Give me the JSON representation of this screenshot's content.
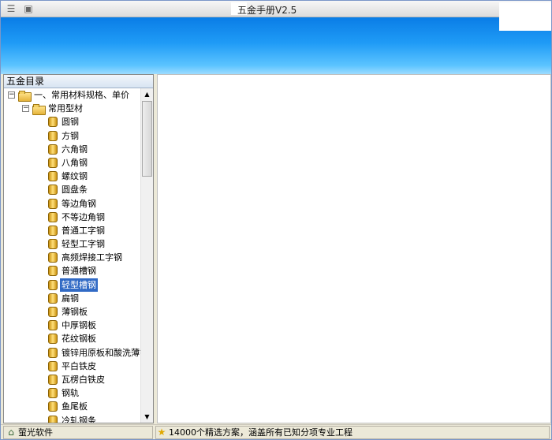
{
  "window": {
    "title": "五金手册V2.5"
  },
  "tree": {
    "header": "五金目录",
    "root": {
      "label": "一、常用材料规格、单价",
      "expander": "−"
    },
    "folder": {
      "label": "常用型材",
      "expander": "−"
    },
    "items": [
      {
        "label": "圆钢"
      },
      {
        "label": "方钢"
      },
      {
        "label": "六角钢"
      },
      {
        "label": "八角钢"
      },
      {
        "label": "螺纹钢"
      },
      {
        "label": "圆盘条"
      },
      {
        "label": "等边角钢"
      },
      {
        "label": "不等边角钢"
      },
      {
        "label": "普通工字钢"
      },
      {
        "label": "轻型工字钢"
      },
      {
        "label": "高频焊接工字钢"
      },
      {
        "label": "普通槽钢"
      },
      {
        "label": "轻型槽钢"
      },
      {
        "label": "扁钢"
      },
      {
        "label": "薄钢板"
      },
      {
        "label": "中厚钢板"
      },
      {
        "label": "花纹钢板"
      },
      {
        "label": "镀锌用原板和酸洗薄钢板"
      },
      {
        "label": "平白铁皮"
      },
      {
        "label": "瓦楞白铁皮"
      },
      {
        "label": "钢轨"
      },
      {
        "label": "鱼尾板"
      },
      {
        "label": "冷轧钢条"
      }
    ],
    "selected": "轻型槽钢"
  },
  "icons": {
    "titlebar_menu": "menu-icon",
    "titlebar_app": "app-icon",
    "status_home": "home-icon",
    "status_star": "star-icon"
  },
  "status": {
    "left": "萤光软件",
    "right": "14000个精选方案，涵盖所有已知分项专业工程"
  },
  "colors": {
    "banner_top": "#0a7de6",
    "banner_bottom": "#9ddcff",
    "selection": "#316ac5"
  }
}
